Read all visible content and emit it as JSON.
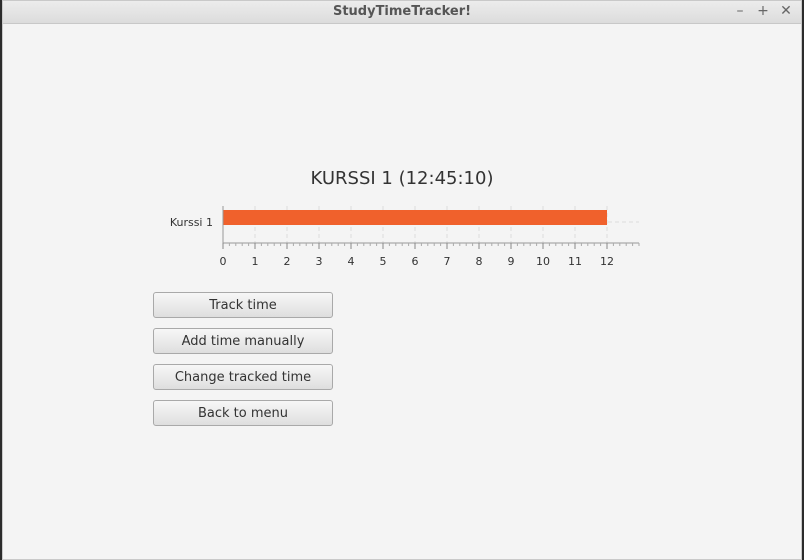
{
  "window": {
    "title": "StudyTimeTracker!",
    "controls": {
      "minimize": "–",
      "maximize": "+",
      "close": "✕"
    }
  },
  "chart_data": {
    "type": "bar",
    "orientation": "horizontal",
    "title": "KURSSI 1 (12:45:10)",
    "categories": [
      "Kurssi 1"
    ],
    "values": [
      12.0
    ],
    "x_ticks": [
      "0",
      "1",
      "2",
      "3",
      "4",
      "5",
      "6",
      "7",
      "8",
      "9",
      "10",
      "11",
      "12"
    ],
    "xlim": [
      0,
      13
    ],
    "bar_color": "#f0612c",
    "grid": true
  },
  "buttons": {
    "track_time": "Track time",
    "add_time_manually": "Add time manually",
    "change_tracked_time": "Change tracked time",
    "back_to_menu": "Back to menu"
  }
}
